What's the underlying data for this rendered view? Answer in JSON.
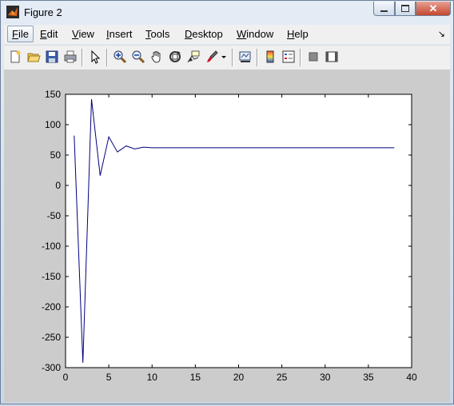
{
  "window": {
    "title": "Figure 2"
  },
  "menu": {
    "items": [
      {
        "label": "File",
        "name": "menu-file"
      },
      {
        "label": "Edit",
        "name": "menu-edit"
      },
      {
        "label": "View",
        "name": "menu-view"
      },
      {
        "label": "Insert",
        "name": "menu-insert"
      },
      {
        "label": "Tools",
        "name": "menu-tools"
      },
      {
        "label": "Desktop",
        "name": "menu-desktop"
      },
      {
        "label": "Window",
        "name": "menu-window"
      },
      {
        "label": "Help",
        "name": "menu-help"
      }
    ],
    "overflow_arrow": "↘"
  },
  "toolbar": {
    "icons": [
      "new-figure-icon",
      "open-file-icon",
      "save-icon",
      "print-icon",
      "edit-plot-arrow-icon",
      "zoom-in-icon",
      "zoom-out-icon",
      "pan-hand-icon",
      "rotate-3d-icon",
      "data-cursor-icon",
      "brush-icon",
      "brush-dropdown-icon",
      "link-plot-icon",
      "insert-colorbar-icon",
      "insert-legend-icon",
      "hide-plot-tools-icon",
      "show-plot-tools-icon"
    ]
  },
  "colors": {
    "line": "#00007f",
    "figure_bg": "#cccccc",
    "axes_bg": "#ffffff"
  },
  "chart_data": {
    "type": "line",
    "title": "",
    "xlabel": "",
    "ylabel": "",
    "xlim": [
      0,
      40
    ],
    "ylim": [
      -300,
      150
    ],
    "x_ticks": [
      0,
      5,
      10,
      15,
      20,
      25,
      30,
      35,
      40
    ],
    "y_ticks": [
      150,
      100,
      50,
      0,
      -50,
      -100,
      -150,
      -200,
      -250,
      -300
    ],
    "grid": false,
    "series": [
      {
        "x": [
          1,
          2,
          3,
          4,
          5,
          6,
          7,
          8,
          9,
          10,
          11,
          12,
          13,
          14,
          15,
          16,
          17,
          18,
          19,
          20,
          21,
          22,
          23,
          24,
          25,
          26,
          27,
          28,
          29,
          30,
          31,
          32,
          33,
          34,
          35,
          36,
          37,
          38
        ],
        "y": [
          82,
          -292,
          142,
          16,
          80,
          55,
          65,
          60,
          63,
          62,
          62,
          62,
          62,
          62,
          62,
          62,
          62,
          62,
          62,
          62,
          62,
          62,
          62,
          62,
          62,
          62,
          62,
          62,
          62,
          62,
          62,
          62,
          62,
          62,
          62,
          62,
          62,
          62
        ]
      }
    ]
  }
}
